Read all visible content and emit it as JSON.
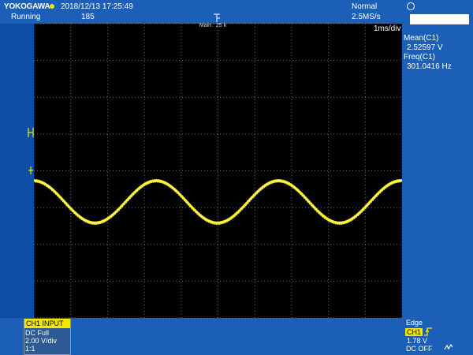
{
  "header": {
    "brand": "YOKOGAWA",
    "datetime": "2018/12/13 17:25:49",
    "status": "Running",
    "acq_count": "185",
    "trigger_mode": "Normal",
    "sample_rate": "2.5MS/s",
    "zoom_label": "Main : 25 k",
    "time_div": "1ms/div"
  },
  "measurements": [
    {
      "label": "Mean(C1)",
      "value": "2.52597 V"
    },
    {
      "label": "Freq(C1)",
      "value": "301.0416 Hz"
    }
  ],
  "channel1": {
    "title": "CH1 INPUT",
    "coupling": "DC Full",
    "scale": "2.00 V/div",
    "probe": "1:1"
  },
  "trigger": {
    "type": "Edge",
    "source": "CH1",
    "level": "1.78 V",
    "coupling": "DC OFF"
  },
  "waveform": {
    "color": "#f2e700",
    "frequency_hz": 301.0416,
    "mean_v": 2.52597,
    "amplitude_v": 1.15,
    "volts_per_div": 2.0,
    "time_per_div_ms": 1.0,
    "time_span_ms": 10.0,
    "vertical_divs": 8,
    "phase_deg": 90
  },
  "colors": {
    "panel_blue": "#1c5fb8",
    "channel_yellow": "#f2e700",
    "grid": "#6a6a6a"
  },
  "icons": {
    "status_icon": "sun-icon",
    "softkey_icon": "circle-icon",
    "edge_icon": "rising-edge-icon",
    "acq_icon": "zigzag-icon"
  }
}
